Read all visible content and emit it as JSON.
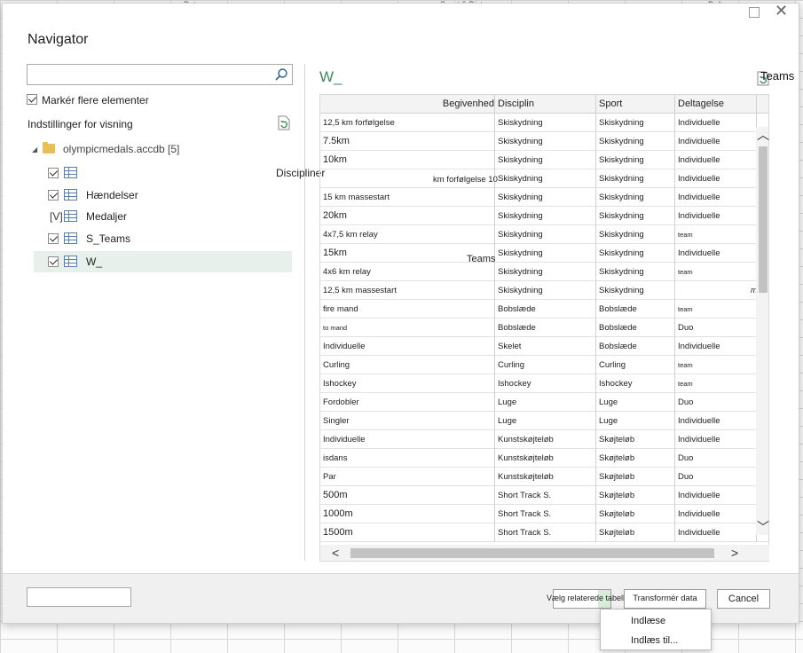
{
  "background": {
    "headers": [
      "Dato",
      "Sport & Dist",
      "Delta..."
    ]
  },
  "dialog": {
    "title": "Navigator",
    "search_placeholder": "",
    "multi_select_label": "Markér flere elementer",
    "display_options_label": "Indstillinger for visning",
    "tree": {
      "root_label": "olympicmedals.accdb [5]",
      "items": [
        {
          "label": "",
          "checked": true,
          "selected": false
        },
        {
          "label": "Hændelser",
          "checked": true,
          "selected": false
        },
        {
          "label": "Medaljer",
          "checked": false,
          "selected": false,
          "mark": "[V]"
        },
        {
          "label": "S_Teams",
          "checked": true,
          "selected": false
        },
        {
          "label": "W_",
          "checked": true,
          "selected": true
        }
      ]
    },
    "stray_labels": {
      "discipliner": "Discipliner",
      "teams_top": "Teams",
      "teams_mid": "Teams",
      "km_for": "km forfølgelse 10",
      "m_fragment": "m"
    },
    "preview": {
      "title": "W_",
      "columns": [
        "Begivenhed",
        "Disciplin",
        "Sport",
        "Deltagelse"
      ],
      "rows": [
        [
          "12,5 km forfølgelse",
          "Skiskydning",
          "Skiskydning",
          "Individuelle"
        ],
        [
          "7.5km",
          "Skiskydning",
          "Skiskydning",
          "Individuelle"
        ],
        [
          "10km",
          "Skiskydning",
          "Skiskydning",
          "Individuelle"
        ],
        [
          "",
          "Skiskydning",
          "Skiskydning",
          "Individuelle"
        ],
        [
          "15 km massestart",
          "Skiskydning",
          "Skiskydning",
          "Individuelle"
        ],
        [
          "20km",
          "Skiskydning",
          "Skiskydning",
          "Individuelle"
        ],
        [
          "4x7,5 km relay",
          "Skiskydning",
          "Skiskydning",
          "team"
        ],
        [
          "15km",
          "Skiskydning",
          "Skiskydning",
          "Individuelle"
        ],
        [
          "4x6 km relay",
          "Skiskydning",
          "Skiskydning",
          "team"
        ],
        [
          "12,5 km massestart",
          "Skiskydning",
          "Skiskydning",
          ""
        ],
        [
          "fire mand",
          "Bobslæde",
          "Bobslæde",
          "team"
        ],
        [
          "to mand",
          "Bobslæde",
          "Bobslæde",
          "Duo"
        ],
        [
          "Individuelle",
          "Skelet",
          "Bobslæde",
          "Individuelle"
        ],
        [
          "Curling",
          "Curling",
          "Curling",
          "team"
        ],
        [
          "Ishockey",
          "Ishockey",
          "Ishockey",
          "team"
        ],
        [
          "Fordobler",
          "Luge",
          "Luge",
          "Duo"
        ],
        [
          "Singler",
          "Luge",
          "Luge",
          "Individuelle"
        ],
        [
          "Individuelle",
          "Kunstskøjteløb",
          "Skøjteløb",
          "Individuelle"
        ],
        [
          "isdans",
          "Kunstskøjteløb",
          "Skøjteløb",
          "Duo"
        ],
        [
          "Par",
          "Kunstskøjteløb",
          "Skøjteløb",
          "Duo"
        ],
        [
          "500m",
          "Short Track S.",
          "Skøjteløb",
          "Individuelle"
        ],
        [
          "1000m",
          "Short Track S.",
          "Skøjteløb",
          "Individuelle"
        ],
        [
          "1500m",
          "Short Track S.",
          "Skøjteløb",
          "Individuelle"
        ]
      ]
    },
    "footer": {
      "select_related_label": "Vælg relaterede tabeller",
      "transform_label": "Transformér data",
      "cancel_label": "Cancel"
    },
    "load_menu": {
      "load_label": "Indlæse",
      "load_to_label": "Indlæs til..."
    }
  }
}
